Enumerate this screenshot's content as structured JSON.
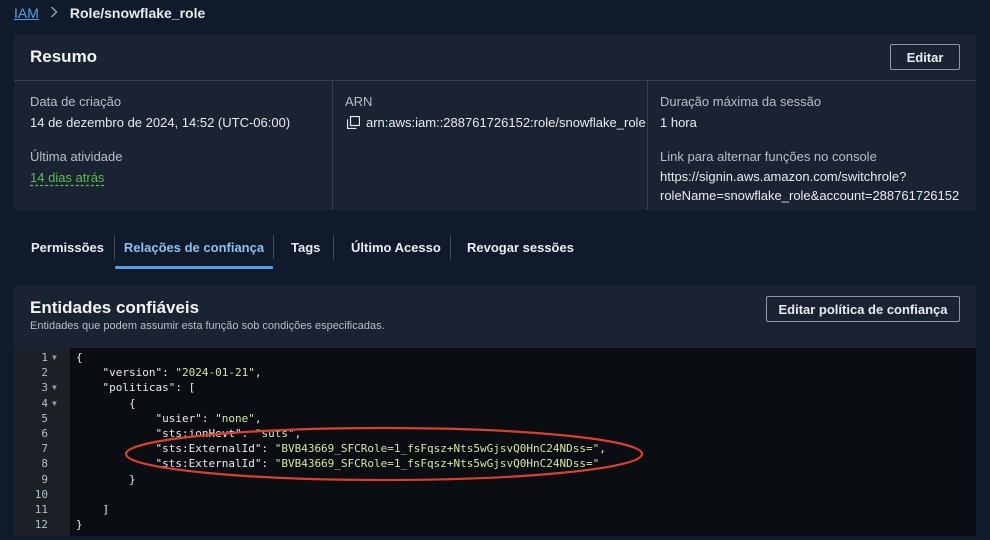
{
  "breadcrumb": {
    "root": "IAM",
    "current": "Role/snowflake_role"
  },
  "summary": {
    "title": "Resumo",
    "edit_label": "Editar",
    "created_label": "Data de criação",
    "created_value": "14 de dezembro de 2024, 14:52 (UTC-06:00)",
    "last_activity_label": "Última atividade",
    "last_activity_value": "14 dias atrás",
    "arn_label": "ARN",
    "arn_value": "arn:aws:iam::288761726152:role/snowflake_role",
    "max_session_label": "Duração máxima da sessão",
    "max_session_value": "1 hora",
    "switch_link_label": "Link para alternar funções no console",
    "switch_link_line1": "https://signin.aws.amazon.com/switchrole?",
    "switch_link_line2": "roleName=snowflake_role&account=288761726152"
  },
  "tabs": [
    {
      "label": "Permissões"
    },
    {
      "label": "Relações de confiança",
      "active": true
    },
    {
      "label": "Tags"
    },
    {
      "label": "Último Acesso"
    },
    {
      "label": "Revogar sessões"
    }
  ],
  "trust": {
    "title": "Entidades confiáveis",
    "subtitle": "Entidades que podem assumir esta função sob condições especificadas.",
    "edit_policy_label": "Editar política de confiança"
  },
  "editor": {
    "lines": [
      {
        "n": "1",
        "text": "{"
      },
      {
        "n": "2",
        "text": "    \"version\": \"2024-01-21\","
      },
      {
        "n": "3",
        "text": "    \"politicas\": ["
      },
      {
        "n": "4",
        "text": "        {"
      },
      {
        "n": "5",
        "text": "            \"usier\": \"none\","
      },
      {
        "n": "6",
        "text": "            \"sts:ionHevt\": \"suts\","
      },
      {
        "n": "7",
        "text": "            \"sts:ExternalId\": \"BVB43669_SFCRole=1_fsFqsz+Nts5wGjsvQ0HnC24NDss=\","
      },
      {
        "n": "8",
        "text": "            \"sts:ExternalId\": \"BVB43669_SFCRole=1_fsFqsz+Nts5wGjsvQ0HnC24NDss=\""
      },
      {
        "n": "9",
        "text": "        }"
      },
      {
        "n": "10",
        "text": ""
      },
      {
        "n": "11",
        "text": "    ]"
      },
      {
        "n": "12",
        "text": "}"
      }
    ]
  },
  "colors": {
    "background": "#0f1b2a",
    "panel": "#1a2331",
    "accent_blue": "#539fe5",
    "link_green": "#5fba54",
    "string_color": "#d6e6a0",
    "annotation_red": "#d8402f"
  },
  "icons": {
    "breadcrumb_separator": "chevron-right-icon",
    "arn_copy": "copy-icon",
    "fold": "fold-arrow-icon"
  }
}
